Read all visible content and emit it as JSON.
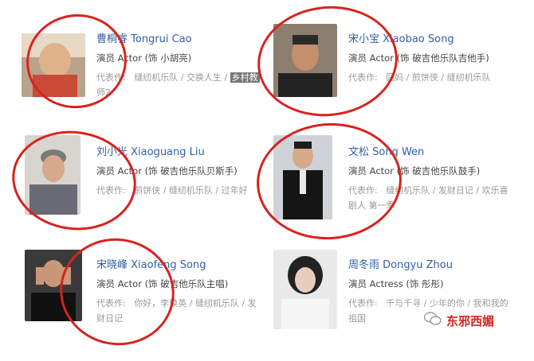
{
  "actors": [
    {
      "name": "曹桐睿 Tongrui Cao",
      "role": "演员 Actor (饰 小胡亮)",
      "works_label": "代表作:",
      "works": "缝纫机乐队 / 交换人生 / 乡村教",
      "works2": "师2",
      "highlight": "乡村教"
    },
    {
      "name": "宋小宝 Xiaobao Song",
      "role": "演员 Actor (饰 破吉他乐队吉他手)",
      "works_label": "代表作:",
      "works": "囧妈 / 煎饼侠 / 缝纫机乐队",
      "works2": ""
    },
    {
      "name": "刘小光 Xiaoguang Liu",
      "role": "演员 Actor (饰 破吉他乐队贝斯手)",
      "works_label": "代表作:",
      "works": "煎饼侠 / 缝纫机乐队 / 过年好",
      "works2": ""
    },
    {
      "name": "文松 Song Wen",
      "role": "演员 Actor (饰 破吉他乐队鼓手)",
      "works_label": "代表作:",
      "works": "缝纫机乐队 / 发财日记 / 欢乐喜",
      "works2": "剧人 第一季"
    },
    {
      "name": "宋晓峰 Xiaofeng Song",
      "role": "演员 Actor (饰 破吉他乐队主唱)",
      "works_label": "代表作:",
      "works": "你好，李焕英 / 缝纫机乐队 / 发",
      "works2": "财日记"
    },
    {
      "name": "周冬雨 Dongyu Zhou",
      "role": "演员 Actress (饰 彤彤)",
      "works_label": "代表作:",
      "works": "千与千寻 / 少年的你 / 我和我的",
      "works2": "祖国"
    }
  ],
  "watermark": {
    "text": "东邪西媚",
    "icon": "wechat-icon"
  },
  "colors": {
    "link": "#2f5fa8",
    "circle": "#d8231f"
  }
}
